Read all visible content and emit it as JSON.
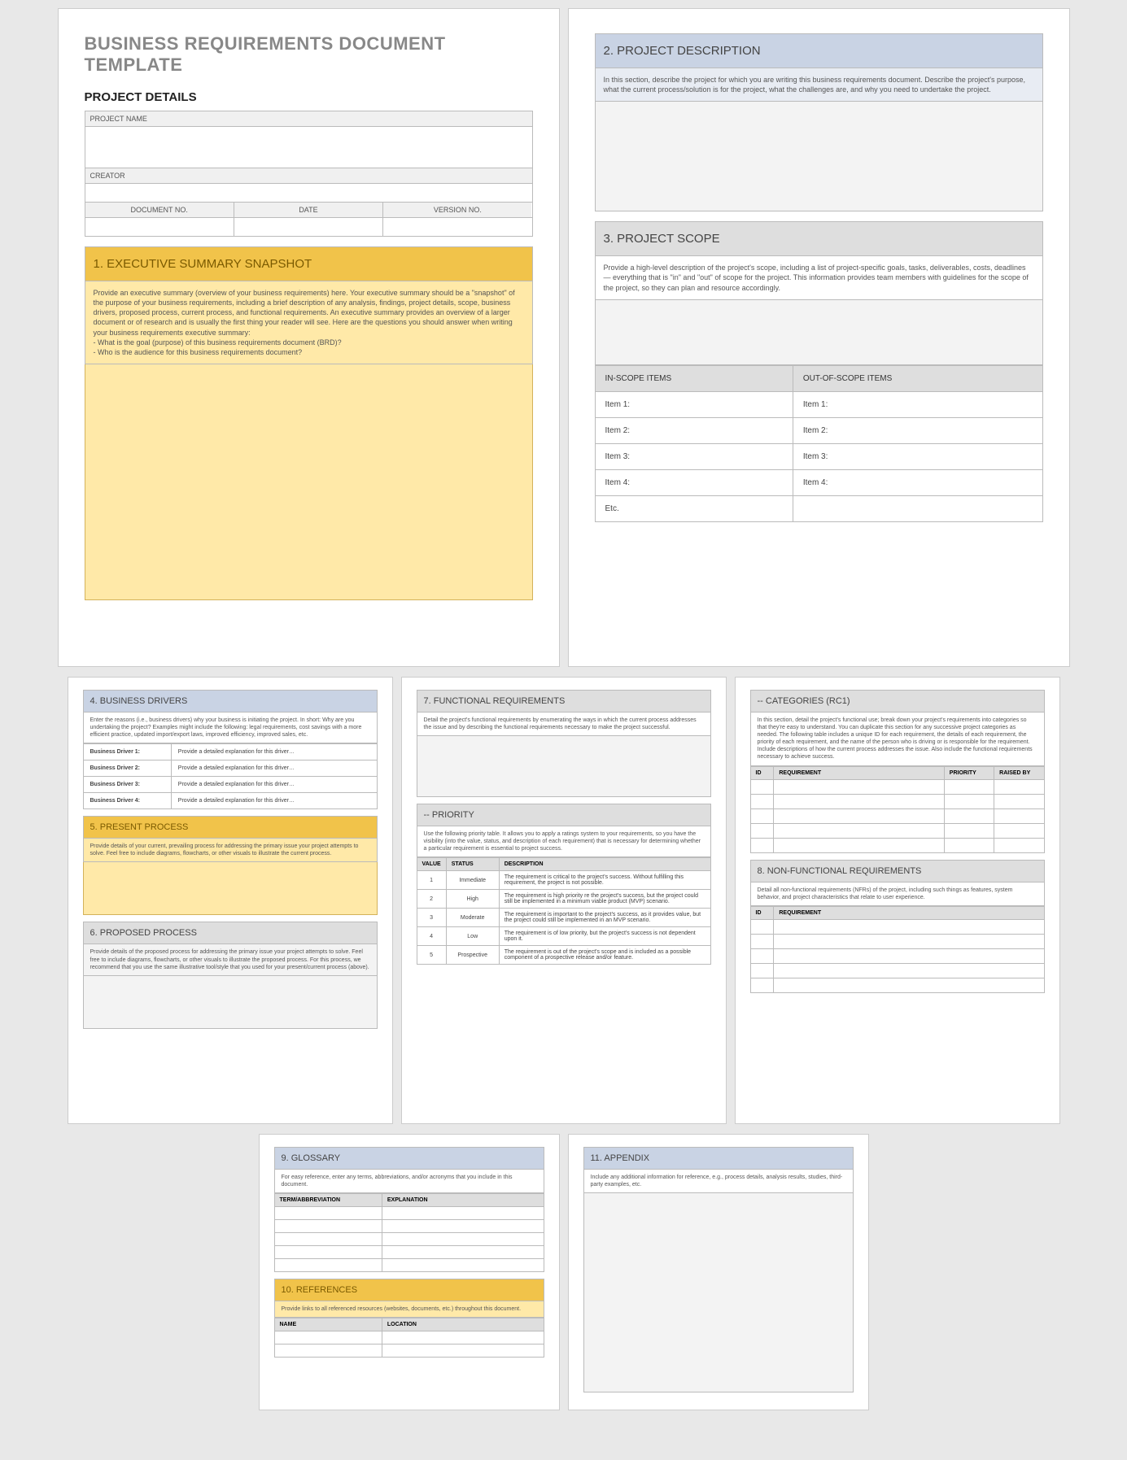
{
  "title": "BUSINESS REQUIREMENTS DOCUMENT TEMPLATE",
  "project_details": {
    "heading": "PROJECT DETAILS",
    "project_name_label": "PROJECT NAME",
    "creator_label": "CREATOR",
    "doc_no_label": "DOCUMENT NO.",
    "date_label": "DATE",
    "version_label": "VERSION NO."
  },
  "sec1": {
    "title": "1. EXECUTIVE SUMMARY SNAPSHOT",
    "body": "Provide an executive summary (overview of your business requirements) here. Your executive summary should be a \"snapshot\" of the purpose of your business requirements, including a brief description of any analysis, findings, project details, scope, business drivers, proposed process, current process, and functional requirements. An executive summary provides an overview of a larger document or of research and is usually the first thing your reader will see. Here are the questions you should answer when writing your business requirements executive summary:\n- What is the goal (purpose) of this business requirements document (BRD)?\n- Who is the audience for this business requirements document?"
  },
  "sec2": {
    "title": "2. PROJECT DESCRIPTION",
    "body": "In this section, describe the project for which you are writing this business requirements document. Describe the project's purpose, what the current process/solution is for the project, what the challenges are, and why you need to undertake the project."
  },
  "sec3": {
    "title": "3. PROJECT SCOPE",
    "body": "Provide a high-level description of the project's scope, including a list of project-specific goals, tasks, deliverables, costs, deadlines — everything that is \"in\" and \"out\" of scope for the project. This information provides team members with guidelines for the scope of the project, so they can plan and resource accordingly.",
    "in_scope": "IN-SCOPE ITEMS",
    "out_scope": "OUT-OF-SCOPE ITEMS",
    "rows": [
      [
        "Item 1:",
        "Item 1:"
      ],
      [
        "Item 2:",
        "Item 2:"
      ],
      [
        "Item 3:",
        "Item 3:"
      ],
      [
        "Item 4:",
        "Item 4:"
      ],
      [
        "Etc.",
        ""
      ]
    ]
  },
  "sec4": {
    "title": "4. BUSINESS DRIVERS",
    "body": "Enter the reasons (i.e., business drivers) why your business is initiating the project. In short: Why are you undertaking the project? Examples might include the following: legal requirements, cost savings with a more efficient practice, updated import/export laws, improved efficiency, improved sales, etc.",
    "rows": [
      [
        "Business Driver 1:",
        "Provide a detailed explanation for this driver…"
      ],
      [
        "Business Driver 2:",
        "Provide a detailed explanation for this driver…"
      ],
      [
        "Business Driver 3:",
        "Provide a detailed explanation for this driver…"
      ],
      [
        "Business Driver 4:",
        "Provide a detailed explanation for this driver…"
      ]
    ]
  },
  "sec5": {
    "title": "5. PRESENT PROCESS",
    "body": "Provide details of your current, prevailing process for addressing the primary issue your project attempts to solve. Feel free to include diagrams, flowcharts, or other visuals to illustrate the current process."
  },
  "sec6": {
    "title": "6. PROPOSED PROCESS",
    "body": "Provide details of the proposed process for addressing the primary issue your project attempts to solve. Feel free to include diagrams, flowcharts, or other visuals to illustrate the proposed process. For this process, we recommend that you use the same illustrative tool/style that you used for your present/current process (above)."
  },
  "sec7": {
    "title": "7. FUNCTIONAL REQUIREMENTS",
    "body": "Detail the project's functional requirements by enumerating the ways in which the current process addresses the issue and by describing the functional requirements necessary to make the project successful."
  },
  "priority": {
    "title": "-- PRIORITY",
    "body": "Use the following priority table. It allows you to apply a ratings system to your requirements, so you have the visibility (into the value, status, and description of each requirement) that is necessary for determining whether a particular requirement is essential to project success.",
    "headers": [
      "VALUE",
      "STATUS",
      "DESCRIPTION"
    ],
    "rows": [
      [
        "1",
        "Immediate",
        "The requirement is critical to the project's success. Without fulfilling this requirement, the project is not possible."
      ],
      [
        "2",
        "High",
        "The requirement is high priority re the project's success, but the project could still be implemented in a minimum viable product (MVP) scenario."
      ],
      [
        "3",
        "Moderate",
        "The requirement is important to the project's success, as it provides value, but the project could still be implemented in an MVP scenario."
      ],
      [
        "4",
        "Low",
        "The requirement is of low priority, but the project's success is not dependent upon it."
      ],
      [
        "5",
        "Prospective",
        "The requirement is out of the project's scope and is included as a possible component of a prospective release and/or feature."
      ]
    ]
  },
  "categories": {
    "title": "-- CATEGORIES (RC1)",
    "body": "In this section, detail the project's functional use; break down your project's requirements into categories so that they're easy to understand. You can duplicate this section for any successive project categories as needed. The following table includes a unique ID for each requirement, the details of each requirement, the priority of each requirement, and the name of the person who is driving or is responsible for the requirement. Include descriptions of how the current process addresses the issue. Also include the functional requirements necessary to achieve success.",
    "headers": [
      "ID",
      "REQUIREMENT",
      "PRIORITY",
      "RAISED BY"
    ]
  },
  "sec8": {
    "title": "8. NON-FUNCTIONAL REQUIREMENTS",
    "body": "Detail all non-functional requirements (NFRs) of the project, including such things as features, system behavior, and project characteristics that relate to user experience.",
    "headers": [
      "ID",
      "REQUIREMENT"
    ]
  },
  "sec9": {
    "title": "9. GLOSSARY",
    "body": "For easy reference, enter any terms, abbreviations, and/or acronyms that you include in this document.",
    "headers": [
      "TERM/ABBREVIATION",
      "EXPLANATION"
    ]
  },
  "sec10": {
    "title": "10. REFERENCES",
    "body": "Provide links to all referenced resources (websites, documents, etc.) throughout this document.",
    "headers": [
      "NAME",
      "LOCATION"
    ]
  },
  "sec11": {
    "title": "11. APPENDIX",
    "body": "Include any additional information for reference, e.g., process details, analysis results, studies, third-party examples, etc."
  }
}
